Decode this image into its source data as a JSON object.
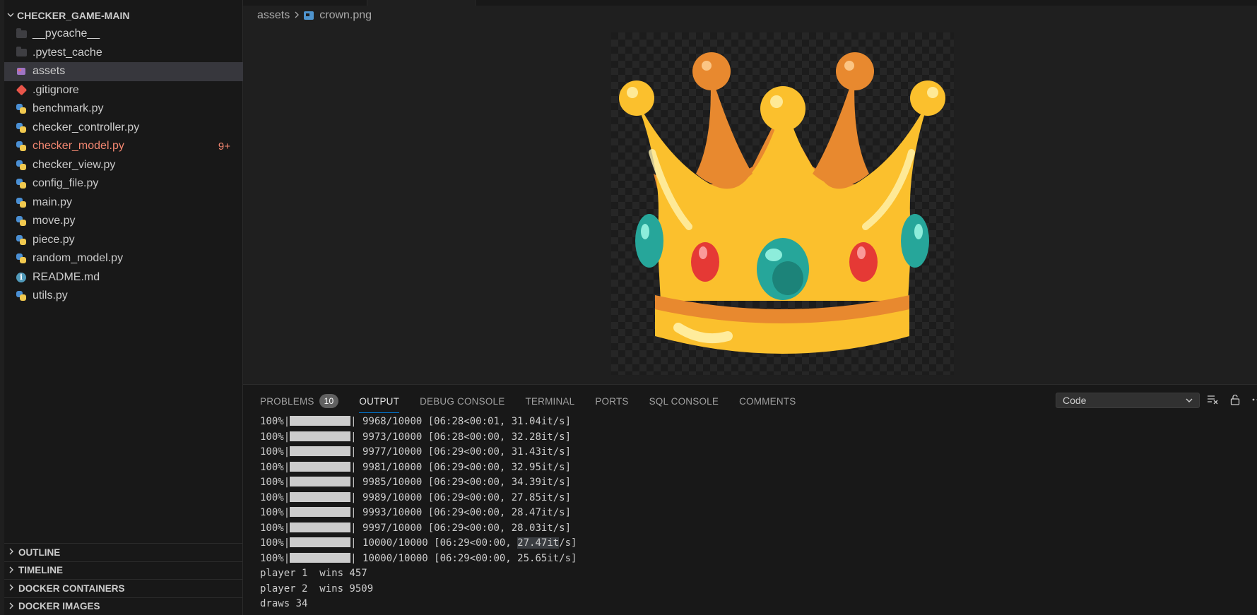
{
  "explorer": {
    "root_folder": "CHECKER_GAME-MAIN",
    "items": [
      {
        "name": "__pycache__",
        "kind": "folder"
      },
      {
        "name": ".pytest_cache",
        "kind": "folder"
      },
      {
        "name": "assets",
        "kind": "image-folder",
        "selected": true
      },
      {
        "name": ".gitignore",
        "kind": "git"
      },
      {
        "name": "benchmark.py",
        "kind": "python"
      },
      {
        "name": "checker_controller.py",
        "kind": "python"
      },
      {
        "name": "checker_model.py",
        "kind": "python",
        "error": true,
        "badge": "9+"
      },
      {
        "name": "checker_view.py",
        "kind": "python"
      },
      {
        "name": "config_file.py",
        "kind": "python"
      },
      {
        "name": "main.py",
        "kind": "python"
      },
      {
        "name": "move.py",
        "kind": "python"
      },
      {
        "name": "piece.py",
        "kind": "python"
      },
      {
        "name": "random_model.py",
        "kind": "python"
      },
      {
        "name": "README.md",
        "kind": "info"
      },
      {
        "name": "utils.py",
        "kind": "python"
      }
    ],
    "sections": [
      "OUTLINE",
      "TIMELINE",
      "DOCKER CONTAINERS",
      "DOCKER IMAGES"
    ]
  },
  "editor": {
    "breadcrumb": [
      "assets",
      "crown.png"
    ],
    "image_name": "crown.png"
  },
  "panel": {
    "tabs": [
      {
        "label": "PROBLEMS",
        "count": "10"
      },
      {
        "label": "OUTPUT",
        "active": true
      },
      {
        "label": "DEBUG CONSOLE"
      },
      {
        "label": "TERMINAL"
      },
      {
        "label": "PORTS"
      },
      {
        "label": "SQL CONSOLE"
      },
      {
        "label": "COMMENTS"
      }
    ],
    "output_channel": "Code",
    "progress_lines": [
      {
        "pct": "100%|",
        "rest": "| 9968/10000 [06:28<00:01, 31.04it/s]"
      },
      {
        "pct": "100%|",
        "rest": "| 9973/10000 [06:28<00:00, 32.28it/s]"
      },
      {
        "pct": "100%|",
        "rest": "| 9977/10000 [06:29<00:00, 31.43it/s]"
      },
      {
        "pct": "100%|",
        "rest": "| 9981/10000 [06:29<00:00, 32.95it/s]"
      },
      {
        "pct": "100%|",
        "rest": "| 9985/10000 [06:29<00:00, 34.39it/s]"
      },
      {
        "pct": "100%|",
        "rest": "| 9989/10000 [06:29<00:00, 27.85it/s]"
      },
      {
        "pct": "100%|",
        "rest": "| 9993/10000 [06:29<00:00, 28.47it/s]"
      },
      {
        "pct": "100%|",
        "rest": "| 9997/10000 [06:29<00:00, 28.03it/s]"
      },
      {
        "pct": "100%|",
        "rest_a": "| 10000/10000 [06:29<00:00, ",
        "highlight": "27.47it",
        "rest_b": "/s]"
      },
      {
        "pct": "100%|",
        "rest": "| 10000/10000 [06:29<00:00, 25.65it/s]"
      }
    ],
    "result_lines": [
      "player 1  wins 457",
      "player 2  wins 9509",
      "draws 34"
    ]
  }
}
